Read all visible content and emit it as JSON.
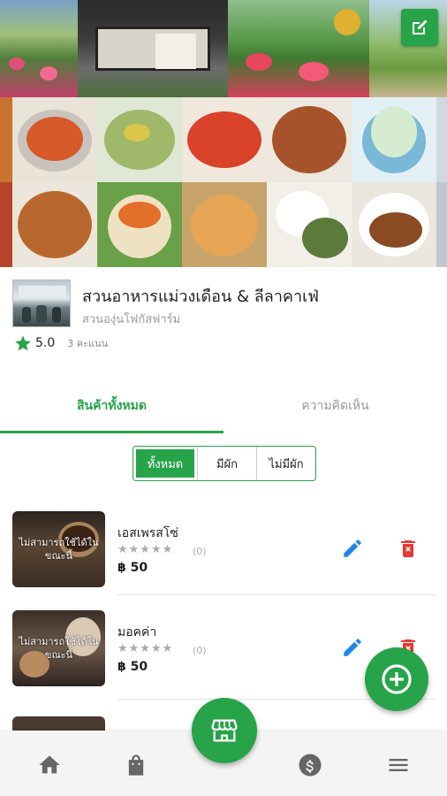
{
  "colors": {
    "accent": "#27a34a",
    "delete": "#e53935",
    "edit": "#1e88e5"
  },
  "shop": {
    "name": "สวนอาหารแม่วงเดือน & ลีลาคาเฟ่",
    "subtitle": "สวนองุ่นโฟกัสฟาร์ม",
    "rating": "5.0",
    "rating_count": "3 คะแนน"
  },
  "tabs": [
    {
      "label": "สินค้าทั้งหมด",
      "active": true
    },
    {
      "label": "ความคิดเห็น",
      "active": false
    }
  ],
  "filters": [
    {
      "label": "ทั้งหมด",
      "active": true
    },
    {
      "label": "มีผัก",
      "active": false
    },
    {
      "label": "ไม่มีผัก",
      "active": false
    }
  ],
  "products": [
    {
      "name": "เอสเพรสโซ่",
      "stars": "★★★★★",
      "reviews": "(0)",
      "price": "฿ 50",
      "image_text": "ไม่สามารถใช้ได้ในขณะนี้"
    },
    {
      "name": "มอคค่า",
      "stars": "★★★★★",
      "reviews": "(0)",
      "price": "฿ 50",
      "image_text": "ไม่สามารถใช้ได้ในขณะนี้"
    }
  ],
  "icons": {
    "cover_edit": "edit-square-icon",
    "rating": "star-icon",
    "edit": "pencil-icon",
    "delete": "delete-icon",
    "add": "add-circle-icon",
    "nav": [
      "home-icon",
      "shopping-bag-icon",
      "storefront-icon",
      "dollar-icon",
      "menu-icon"
    ]
  }
}
